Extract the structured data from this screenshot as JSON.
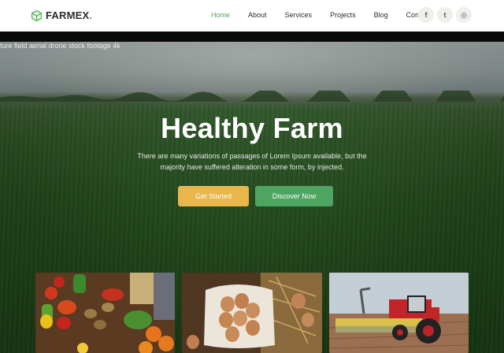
{
  "header": {
    "logo_text": "FARMEX",
    "logo_dot": ".",
    "nav": [
      {
        "label": "Home",
        "active": true
      },
      {
        "label": "About",
        "active": false
      },
      {
        "label": "Services",
        "active": false
      },
      {
        "label": "Projects",
        "active": false
      },
      {
        "label": "Blog",
        "active": false
      },
      {
        "label": "Contact",
        "active": false
      }
    ],
    "social": [
      {
        "icon": "facebook-icon",
        "glyph": "f"
      },
      {
        "icon": "twitter-icon",
        "glyph": "t"
      },
      {
        "icon": "instagram-icon",
        "glyph": "◎"
      }
    ]
  },
  "hero": {
    "caption": "ture field aerial drone stock footage 4k",
    "title": "Healthy Farm",
    "subtitle": "There are many variations of passages of Lorem Ipsum available, but the majority have suffered alteration in some form, by injected.",
    "buttons": {
      "start": "Get Started",
      "discover": "Discover Now"
    }
  },
  "cards": [
    {
      "name": "vegetables-image"
    },
    {
      "name": "eggs-image"
    },
    {
      "name": "tractor-image"
    }
  ],
  "colors": {
    "accent_green": "#4ea562",
    "accent_yellow": "#e8b64a",
    "header_bg": "#ffffff"
  }
}
